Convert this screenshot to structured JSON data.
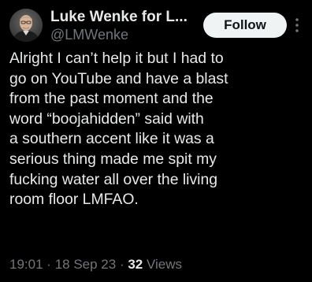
{
  "author": {
    "display_name": "Luke Wenke for L...",
    "handle": "@LMWenke",
    "avatar_icon": "profile-photo"
  },
  "actions": {
    "follow_label": "Follow",
    "more_icon": "more-vertical-icon"
  },
  "tweet": {
    "lines": [
      "Alright I can’t help it but I had to",
      "go on YouTube and have a blast",
      "from the past moment and the",
      "word “boojahidden” said with",
      "a southern accent like it was a",
      "serious thing made me spit my",
      "fucking water all over the living",
      "room floor LMFAO."
    ]
  },
  "meta": {
    "time": "19:01",
    "separator": "·",
    "date": "18 Sep 23",
    "views_count": "32",
    "views_label": "Views"
  },
  "colors": {
    "background": "#000000",
    "text_primary": "#e7e9ea",
    "text_secondary": "#71767b",
    "button_bg": "#eff3f4",
    "button_text": "#0f1419"
  }
}
